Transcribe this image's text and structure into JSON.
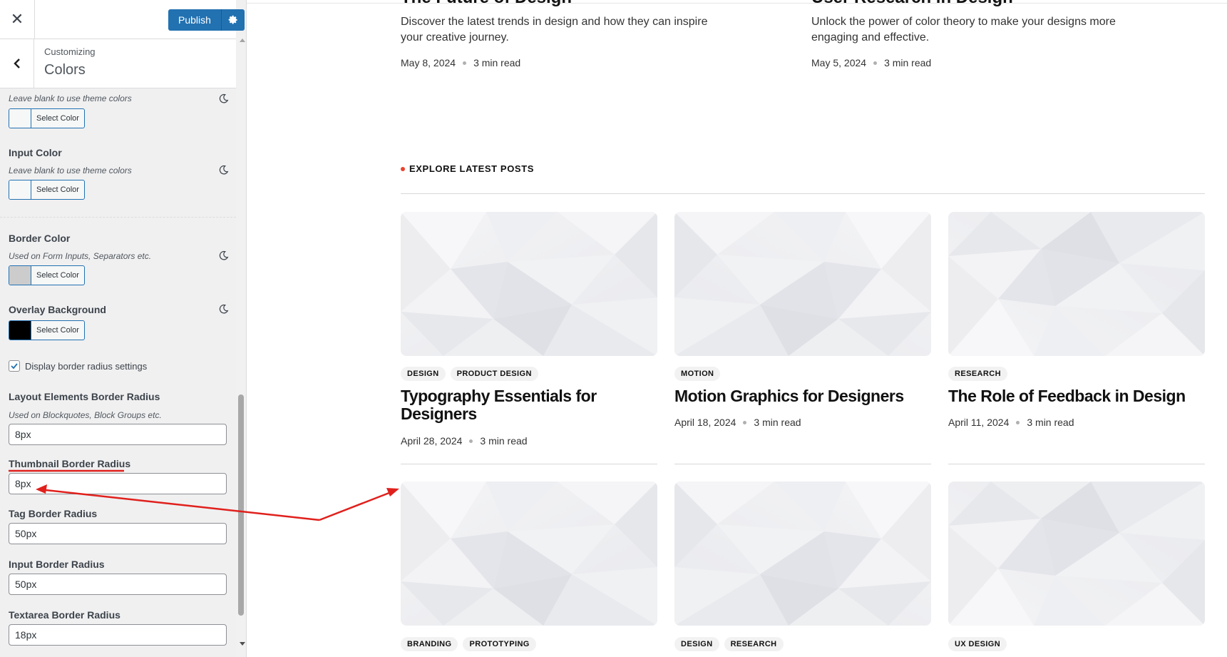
{
  "sidebar": {
    "publish_label": "Publish",
    "customizing_label": "Customizing",
    "section_title": "Colors",
    "first_desc": "Leave blank to use theme colors",
    "select_color_label": "Select Color",
    "input_color": {
      "title": "Input Color",
      "desc": "Leave blank to use theme colors"
    },
    "border_color": {
      "title": "Border Color",
      "desc": "Used on Form Inputs, Separators etc."
    },
    "overlay_bg": {
      "title": "Overlay Background"
    },
    "checkbox_label": "Display border radius settings",
    "checkbox_checked": true,
    "layout_radius": {
      "title": "Layout Elements Border Radius",
      "desc": "Used on Blockquotes, Block Groups etc.",
      "value": "8px"
    },
    "thumb_radius": {
      "title": "Thumbnail Border Radius",
      "value": "8px"
    },
    "tag_radius": {
      "title": "Tag Border Radius",
      "value": "50px"
    },
    "input_radius": {
      "title": "Input Border Radius",
      "value": "50px"
    },
    "textarea_radius": {
      "title": "Textarea Border Radius",
      "value": "18px"
    }
  },
  "colors": {
    "swatch1": "#f6f7f7",
    "swatch2": "#f6f7f7",
    "swatch3": "#cccccc",
    "swatch4": "#000000",
    "publish": "#2271b1",
    "accent_dot": "#e8432e",
    "annotation": "#e0201c"
  },
  "top_posts": [
    {
      "title": "The Future of Design",
      "excerpt": "Discover the latest trends in design and how they can inspire your creative journey.",
      "date": "May 8, 2024",
      "read": "3 min read"
    },
    {
      "title": "User Research in Design",
      "excerpt": "Unlock the power of color theory to make your designs more engaging and effective.",
      "date": "May 5, 2024",
      "read": "3 min read"
    }
  ],
  "explore_label": "EXPLORE LATEST POSTS",
  "posts": [
    {
      "tags": [
        "DESIGN",
        "PRODUCT DESIGN"
      ],
      "title": "Typography Essentials for Designers",
      "date": "April 28, 2024",
      "read": "3 min read"
    },
    {
      "tags": [
        "MOTION"
      ],
      "title": "Motion Graphics for Designers",
      "date": "April 18, 2024",
      "read": "3 min read"
    },
    {
      "tags": [
        "RESEARCH"
      ],
      "title": "The Role of Feedback in Design",
      "date": "April 11, 2024",
      "read": "3 min read"
    }
  ],
  "posts_row2": [
    {
      "tags": [
        "BRANDING",
        "PROTOTYPING"
      ]
    },
    {
      "tags": [
        "DESIGN",
        "RESEARCH"
      ]
    },
    {
      "tags": [
        "UX DESIGN"
      ]
    }
  ]
}
